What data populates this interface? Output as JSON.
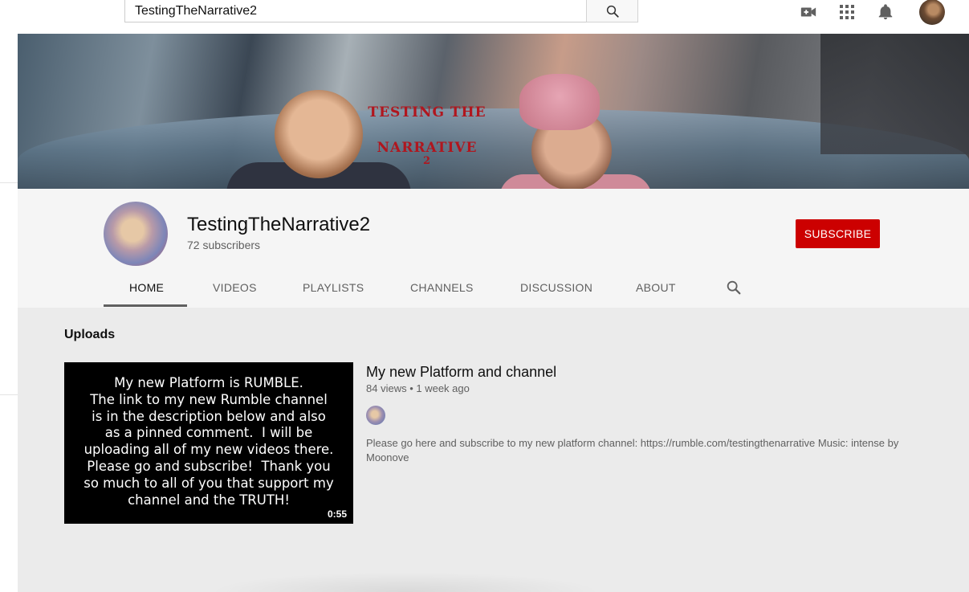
{
  "topbar": {
    "search_value": "TestingTheNarrative2",
    "icons": [
      "create-video-icon",
      "apps-grid-icon",
      "notifications-bell-icon",
      "search-icon"
    ]
  },
  "banner": {
    "text_line1": "TESTING THE",
    "text_line2": "NARRATIVE",
    "text_line3": "2"
  },
  "channel": {
    "name": "TestingTheNarrative2",
    "subscribers": "72 subscribers",
    "subscribe_label": "SUBSCRIBE",
    "accent_color": "#cc0000"
  },
  "tabs": [
    {
      "label": "HOME",
      "active": true
    },
    {
      "label": "VIDEOS"
    },
    {
      "label": "PLAYLISTS"
    },
    {
      "label": "CHANNELS"
    },
    {
      "label": "DISCUSSION"
    },
    {
      "label": "ABOUT"
    }
  ],
  "section": {
    "title": "Uploads"
  },
  "video": {
    "thumbnail_lines": [
      "My new Platform is RUMBLE.",
      "The link to my new Rumble channel",
      "is in the description below and also",
      "as a pinned comment.  I will be",
      "uploading all of my new videos there.",
      "Please go and subscribe!  Thank you",
      "so much to all of you that support my",
      "channel and the TRUTH!"
    ],
    "duration": "0:55",
    "title": "My new Platform and channel",
    "meta": "84 views • 1 week ago",
    "description": "Please go here and subscribe to my new platform channel: https://rumble.com/testingthenarrative Music: intense by Moonove"
  }
}
